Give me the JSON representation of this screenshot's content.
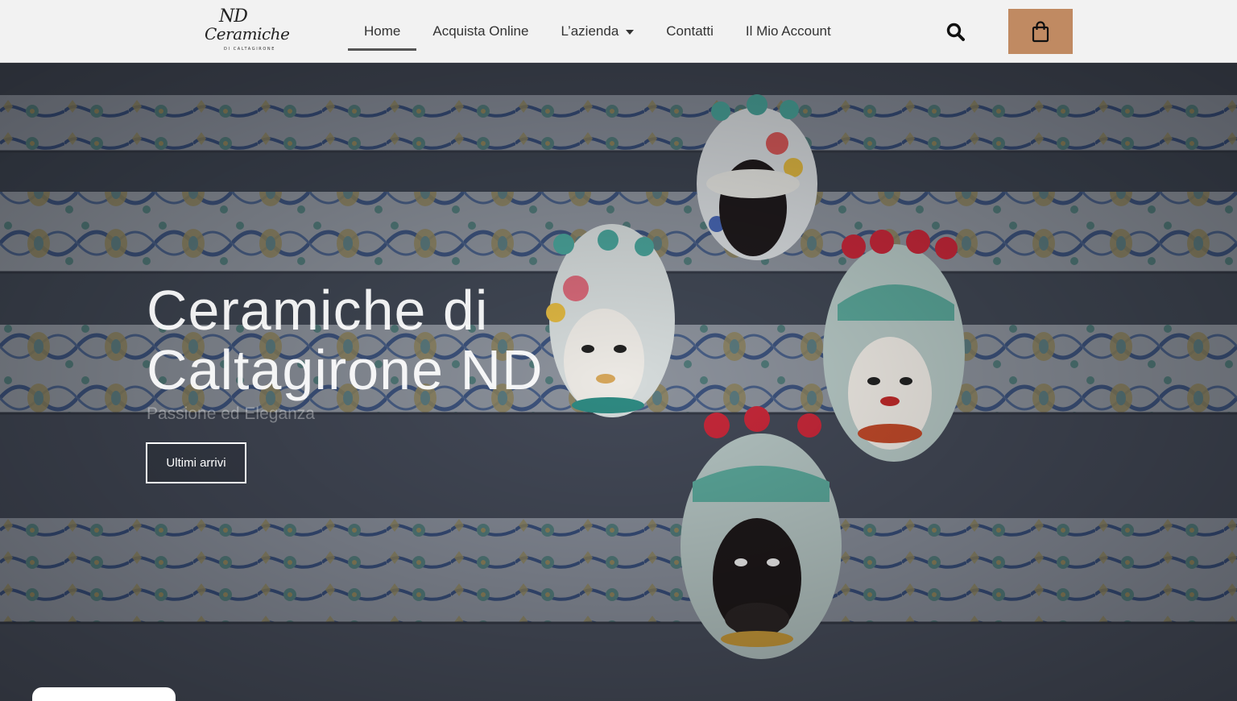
{
  "brand": {
    "logo_initials": "ND",
    "logo_script": "Ceramiche",
    "logo_sub": "DI CALTAGIRONE"
  },
  "nav": {
    "items": [
      {
        "label": "Home",
        "active": true
      },
      {
        "label": "Acquista Online"
      },
      {
        "label": "L’azienda",
        "has_dropdown": true
      },
      {
        "label": "Contatti"
      },
      {
        "label": "Il Mio Account"
      }
    ],
    "search_icon": "search-icon",
    "cart_icon": "shopping-bag-icon"
  },
  "hero": {
    "title": "Ceramiche di Caltagirone ND",
    "subtitle": "Passione ed Eleganza",
    "cta_label": "Ultimi arrivi"
  },
  "colors": {
    "header_bg": "#f2f2f2",
    "cart_button": "#c08a62",
    "nav_text": "#333333"
  }
}
